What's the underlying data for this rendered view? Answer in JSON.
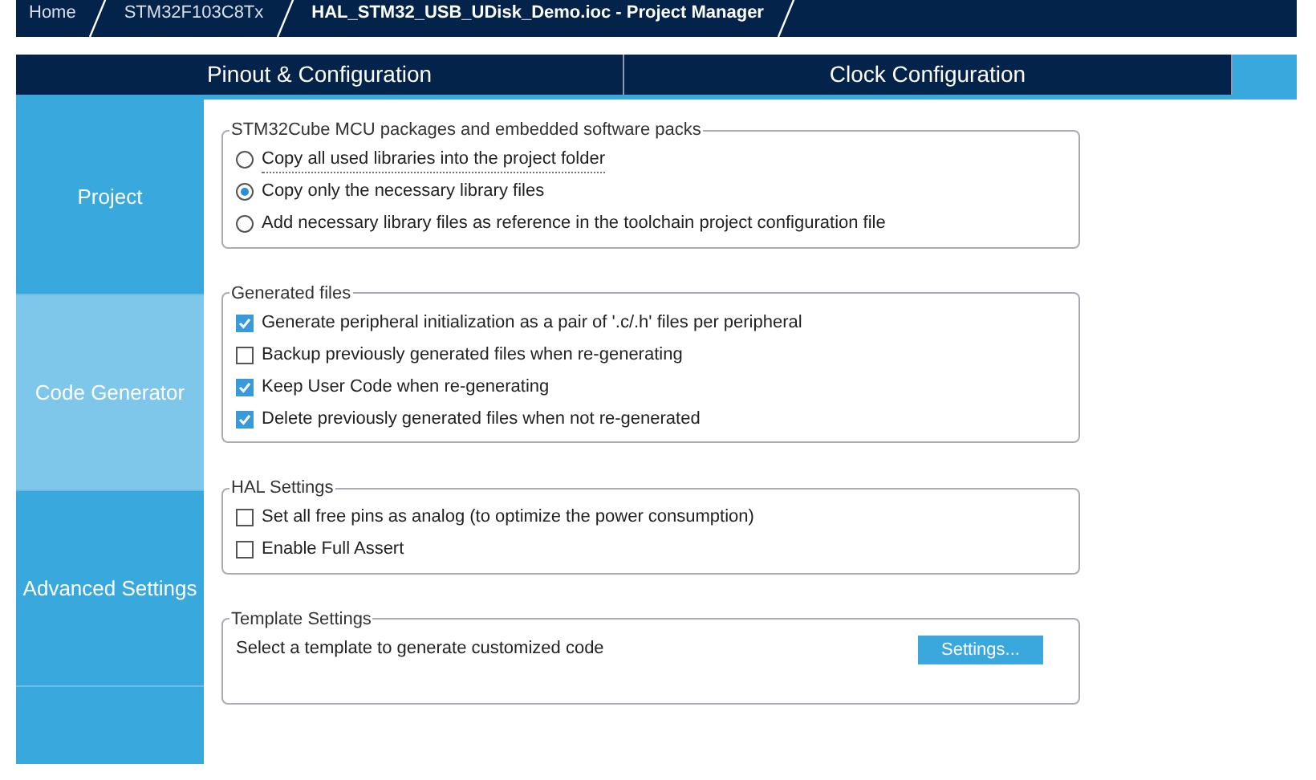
{
  "breadcrumbs": [
    "Home",
    "STM32F103C8Tx",
    "HAL_STM32_USB_UDisk_Demo.ioc - Project Manager"
  ],
  "tabs": [
    "Pinout & Configuration",
    "Clock Configuration"
  ],
  "sidebar": {
    "items": [
      {
        "label": "Project",
        "selected": false
      },
      {
        "label": "Code Generator",
        "selected": true
      },
      {
        "label": "Advanced Settings",
        "selected": false
      }
    ]
  },
  "groups": [
    {
      "kind": "radio",
      "title": "STM32Cube MCU packages and embedded software packs",
      "options": [
        {
          "label": "Copy all used libraries into the project folder",
          "selected": false
        },
        {
          "label": "Copy only the necessary library files",
          "selected": true
        },
        {
          "label": "Add necessary library files as reference in the toolchain project configuration file",
          "selected": false
        }
      ]
    },
    {
      "kind": "checkbox",
      "title": "Generated files",
      "options": [
        {
          "label": "Generate peripheral initialization as a pair of '.c/.h' files per peripheral",
          "checked": true
        },
        {
          "label": "Backup previously generated files when re-generating",
          "checked": false
        },
        {
          "label": "Keep User Code when re-generating",
          "checked": true
        },
        {
          "label": "Delete previously generated files when not re-generated",
          "checked": true
        }
      ]
    },
    {
      "kind": "checkbox",
      "title": "HAL Settings",
      "options": [
        {
          "label": "Set all free pins as analog (to optimize the power consumption)",
          "checked": false
        },
        {
          "label": "Enable Full Assert",
          "checked": false
        }
      ]
    },
    {
      "kind": "template",
      "title": "Template Settings",
      "text": "Select a template to generate customized code",
      "button": "Settings..."
    }
  ]
}
